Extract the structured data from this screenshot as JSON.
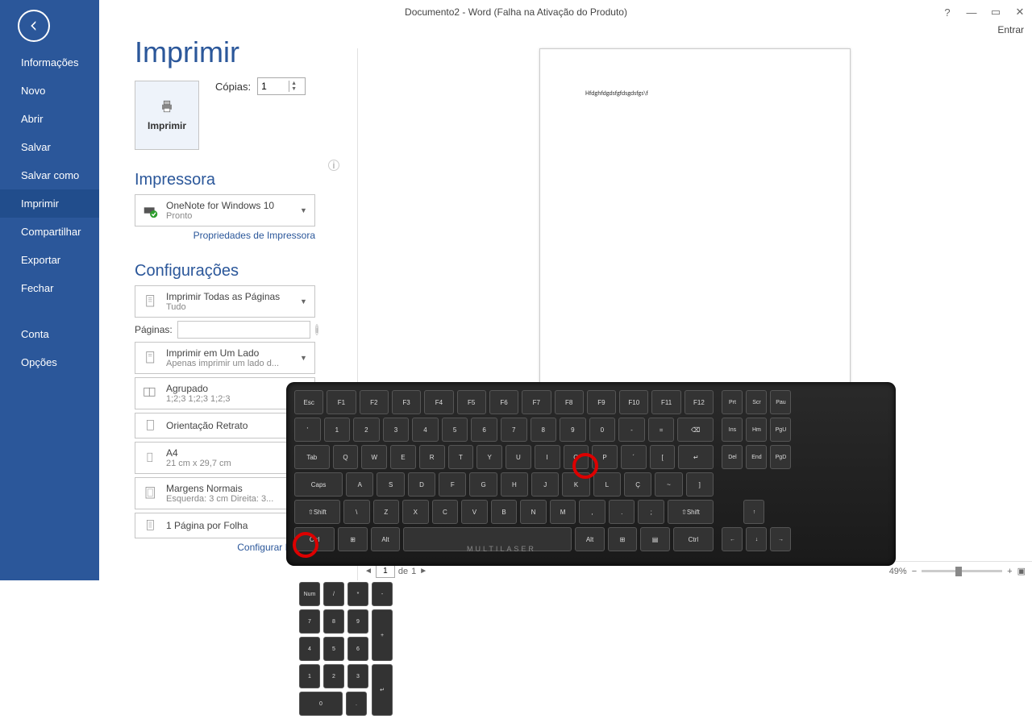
{
  "title": "Documento2 - Word (Falha na Ativação do Produto)",
  "signin": "Entrar",
  "back": "Voltar",
  "sidebar": [
    {
      "label": "Informações"
    },
    {
      "label": "Novo"
    },
    {
      "label": "Abrir"
    },
    {
      "label": "Salvar"
    },
    {
      "label": "Salvar como"
    },
    {
      "label": "Imprimir",
      "selected": true
    },
    {
      "label": "Compartilhar"
    },
    {
      "label": "Exportar"
    },
    {
      "label": "Fechar"
    },
    {
      "label": "Conta",
      "gapBefore": true
    },
    {
      "label": "Opções"
    }
  ],
  "print": {
    "heading": "Imprimir",
    "button": "Imprimir",
    "copies_label": "Cópias:",
    "copies_value": "1",
    "printer_section": "Impressora",
    "printer_name": "OneNote for Windows 10",
    "printer_status": "Pronto",
    "printer_props": "Propriedades de Impressora",
    "settings_section": "Configurações",
    "setting_scope": {
      "title": "Imprimir Todas as Páginas",
      "sub": "Tudo"
    },
    "pages_label": "Páginas:",
    "setting_sides": {
      "title": "Imprimir em Um Lado",
      "sub": "Apenas imprimir um lado d..."
    },
    "setting_collate": {
      "title": "Agrupado",
      "sub": "1;2;3    1;2;3    1;2;3"
    },
    "setting_orient": {
      "title": "Orientação Retrato"
    },
    "setting_size": {
      "title": "A4",
      "sub": "21 cm x 29,7 cm"
    },
    "setting_margins": {
      "title": "Margens Normais",
      "sub": "Esquerda:  3 cm    Direita:  3..."
    },
    "setting_ppp": {
      "title": "1 Página por Folha"
    },
    "page_setup": "Configurar Página"
  },
  "preview": {
    "doc_text": "Hfdghfdgdsfgfdsgdsfgs\\f",
    "page_current": "1",
    "page_sep": "de",
    "page_total": "1",
    "zoom": "49%"
  },
  "keyboard": {
    "brand": "MULTILASER",
    "highlight": [
      "P",
      "Ctrl"
    ]
  }
}
